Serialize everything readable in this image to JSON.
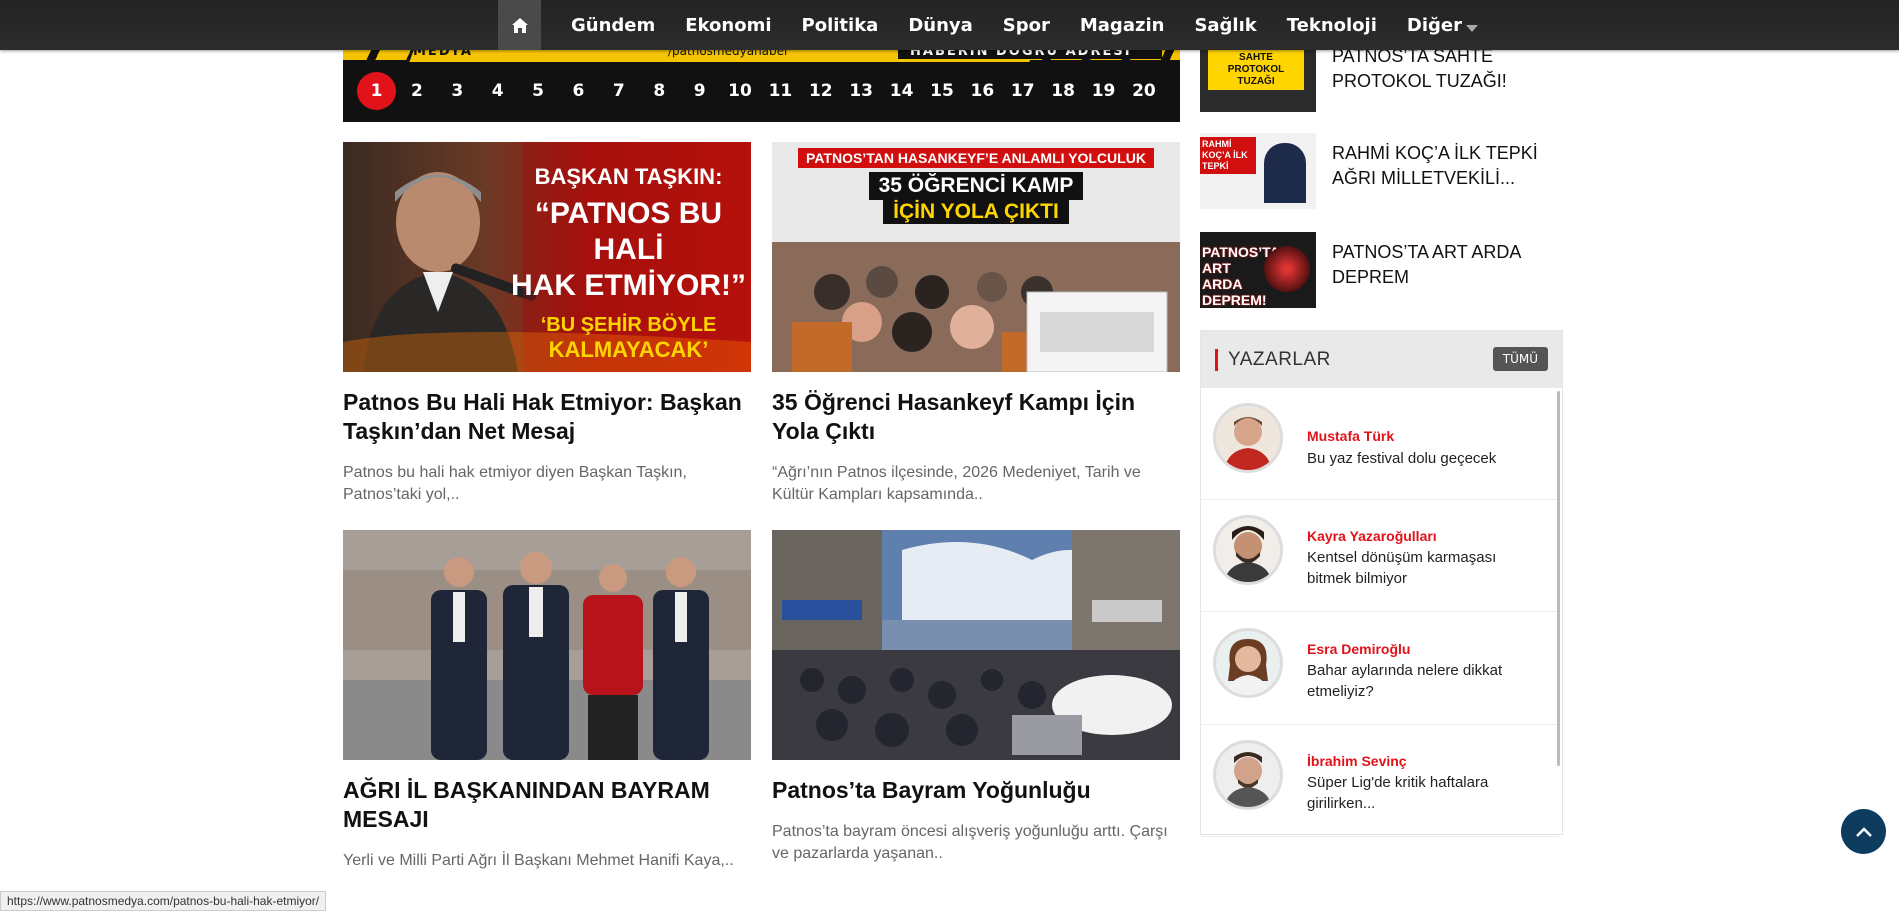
{
  "nav": {
    "items": [
      "Gündem",
      "Ekonomi",
      "Politika",
      "Dünya",
      "Spor",
      "Magazin",
      "Sağlık",
      "Teknoloji"
    ],
    "more_label": "Diğer",
    "home_icon": "home-icon"
  },
  "banner": {
    "brand": "MEDYA",
    "handle": "/patnosmedyahaber",
    "slogan": "HABERİN DOĞRU ADRESİ",
    "pages": [
      "1",
      "2",
      "3",
      "4",
      "5",
      "6",
      "7",
      "8",
      "9",
      "10",
      "11",
      "12",
      "13",
      "14",
      "15",
      "16",
      "17",
      "18",
      "19",
      "20"
    ],
    "active_page": "1"
  },
  "cards": [
    {
      "title": "Patnos Bu Hali Hak Etmiyor: Başkan Taşkın’dan Net Mesaj",
      "desc": "Patnos bu hali hak etmiyor diyen Başkan Taşkın, Patnos’taki yol,..",
      "img": {
        "line1": "BAŞKAN TAŞKIN:",
        "line2": "“PATNOS BU HALİ",
        "line3": "HAK ETMİYOR!”",
        "line4": "‘BU ŞEHİR BÖYLE",
        "line5": "KALMAYACAK’"
      }
    },
    {
      "title": "35 Öğrenci Hasankeyf Kampı İçin Yola Çıktı",
      "desc": "“Ağrı’nın Patnos ilçesinde, 2026 Medeniyet, Tarih ve Kültür Kampları kapsamında..",
      "img": {
        "line1": "PATNOS’TAN HASANKEYF’E ANLAMLI YOLCULUK",
        "line2": "35 ÖĞRENCİ KAMP",
        "line3": "İÇİN YOLA ÇIKTI"
      }
    },
    {
      "title": "AĞRI İL BAŞKANINDAN BAYRAM MESAJI",
      "desc": "Yerli ve Milli Parti Ağrı İl Başkanı Mehmet Hanifi Kaya,..",
      "img": {}
    },
    {
      "title": "Patnos’ta Bayram Yoğunluğu",
      "desc": "Patnos’ta bayram öncesi alışveriş yoğunluğu arttı. Çarşı ve pazarlarda yaşanan..",
      "img": {}
    }
  ],
  "side_news": [
    {
      "title": "PATNOS’TA SAHTE PROTOKOL TUZAĞI!",
      "thumb_text": "SAHTE PROTOKOL TUZAĞI"
    },
    {
      "title": "RAHMİ KOÇ’A İLK TEPKİ AĞRI MİLLETVEKİLİ...",
      "thumb_text": "RAHMİ KOÇ’A İLK TEPKİ"
    },
    {
      "title": "PATNOS’TA ART ARDA DEPREM",
      "thumb_text": "PATNOS’TA ART ARDA DEPREM!"
    }
  ],
  "authors": {
    "title": "YAZARLAR",
    "all_label": "TÜMÜ",
    "items": [
      {
        "name": "Mustafa Türk",
        "text": "Bu yaz festival dolu geçecek"
      },
      {
        "name": "Kayra Yazaroğulları",
        "text": "Kentsel dönüşüm karmaşası bitmek bilmiyor"
      },
      {
        "name": "Esra Demiroğlu",
        "text": "Bahar aylarında nelere dikkat etmeliyiz?"
      },
      {
        "name": "İbrahim Sevinç",
        "text": "Süper Lig'de kritik haftalara girilirken..."
      }
    ]
  },
  "status_url": "https://www.patnosmedya.com/patnos-bu-hali-hak-etmiyor/",
  "colors": {
    "accent": "#e1121a",
    "nav_bg": "#2a2a2a",
    "totop": "#0d3c5f"
  }
}
